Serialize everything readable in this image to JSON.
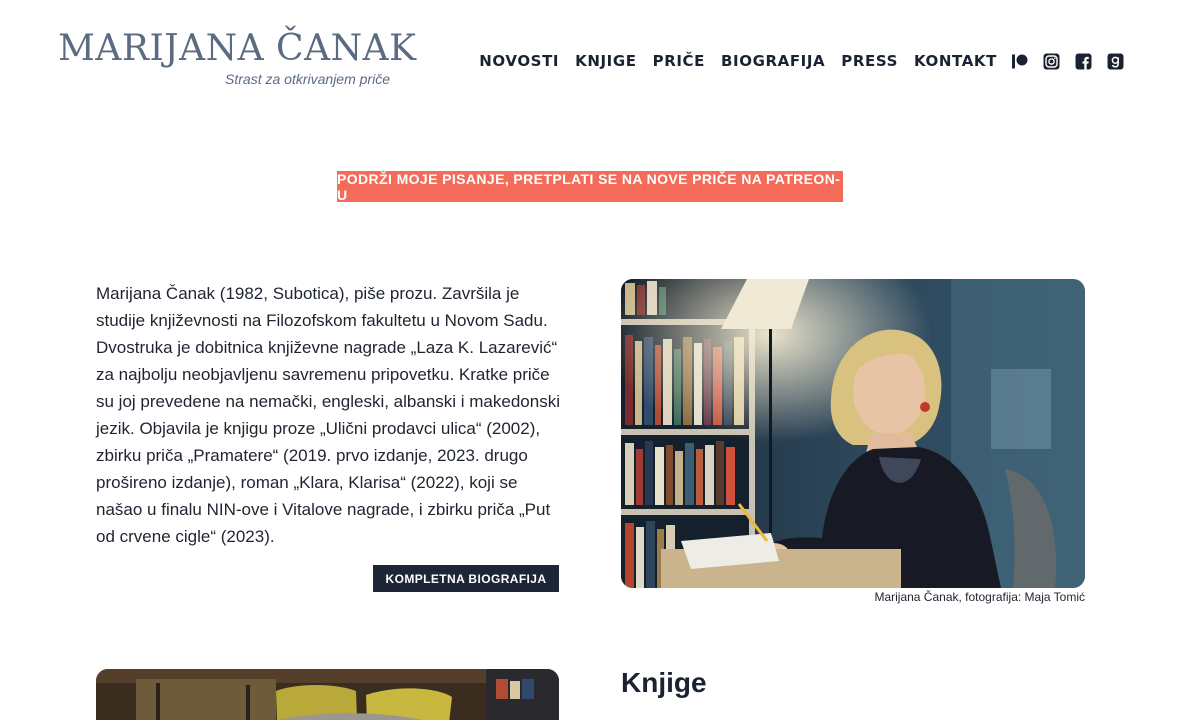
{
  "header": {
    "logo_title": "MARIJANA ČANAK",
    "logo_tagline": "Strast za otkrivanjem priče"
  },
  "nav": {
    "items": [
      {
        "label": "NOVOSTI"
      },
      {
        "label": "KNJIGE"
      },
      {
        "label": "PRIČE"
      },
      {
        "label": "BIOGRAFIJA"
      },
      {
        "label": "PRESS"
      },
      {
        "label": "KONTAKT"
      }
    ],
    "icons": [
      "patreon-icon",
      "instagram-icon",
      "facebook-icon",
      "goodreads-icon"
    ]
  },
  "cta": {
    "label": "PODRŽI MOJE PISANJE, PRETPLATI SE NA NOVE PRIČE NA PATREON-U",
    "color": "#f56b5a"
  },
  "bio": {
    "text": "Marijana Čanak (1982, Subotica), piše prozu. Završila je studije književnosti na Filozofskom fakultetu u Novom Sadu. Dvostruka je dobitnica književne nagrade „Laza K. Lazarević“ za najbolju neobjavljenu savremenu pripovetku. Kratke priče su joj prevedene na nemački, engleski, albanski i makedonski jezik. Objavila je knjigu proze „Ulični prodavci ulica“ (2002), zbirku priča „Pramatere“ (2019. prvo izdanje, 2023. drugo prošireno izdanje), roman „Klara, Klarisa“ (2022), koji se našao u finalu NIN-ove i Vitalove nagrade, i zbirku priča „Put od crvene cigle“ (2023).",
    "button_label": "KOMPLETNA BIOGRAFIJA",
    "button_color": "#1c2636"
  },
  "photo": {
    "caption": "Marijana Čanak, fotografija: Maja Tomić"
  },
  "books_section": {
    "title": "Knjige"
  }
}
